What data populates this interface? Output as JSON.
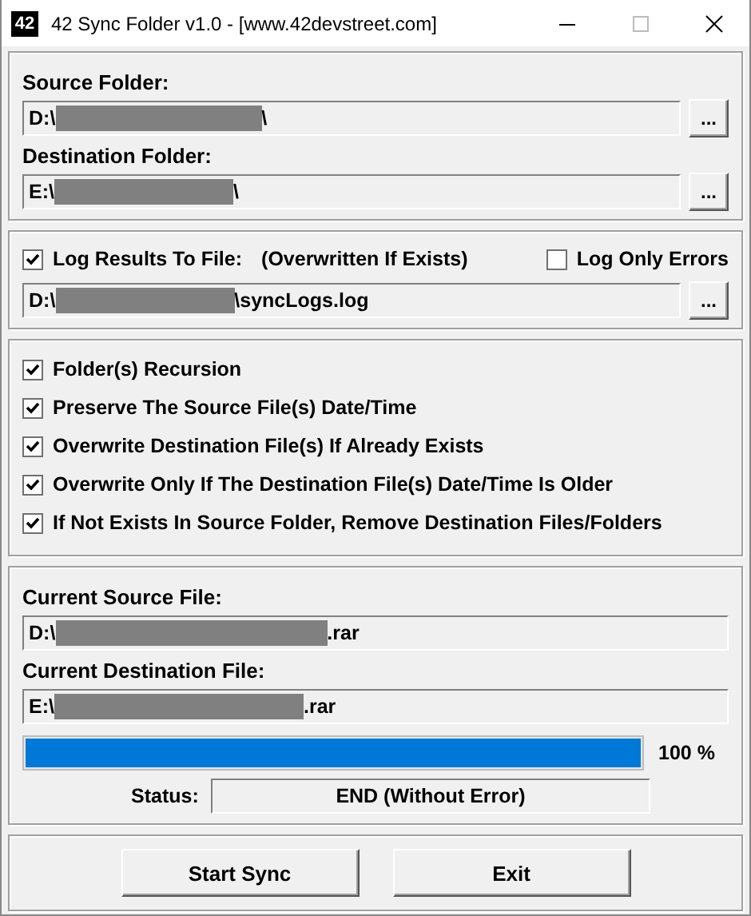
{
  "window": {
    "title": "42 Sync Folder v1.0 - [www.42devstreet.com]",
    "icon_text": "42"
  },
  "folders": [
    {
      "label": "Source Folder:",
      "browse": "...",
      "value": [
        {
          "kind": "text",
          "text": "D:\\"
        },
        {
          "kind": "redacted"
        },
        {
          "kind": "text",
          "text": "\\"
        }
      ]
    },
    {
      "label": "Destination Folder:",
      "browse": "...",
      "value": [
        {
          "kind": "text",
          "text": "E:\\"
        },
        {
          "kind": "redacted"
        },
        {
          "kind": "text",
          "text": "\\"
        }
      ]
    }
  ],
  "log": {
    "log_results": {
      "label": "Log Results To File:",
      "checked": true
    },
    "note": "(Overwritten If Exists)",
    "only_errors": {
      "label": "Log Only Errors",
      "checked": false
    },
    "browse": "...",
    "value": [
      {
        "kind": "text",
        "text": "D:\\"
      },
      {
        "kind": "redacted"
      },
      {
        "kind": "text",
        "text": "\\syncLogs.log"
      }
    ]
  },
  "options": [
    {
      "label": "Folder(s) Recursion",
      "checked": true
    },
    {
      "label": "Preserve The Source File(s) Date/Time",
      "checked": true
    },
    {
      "label": "Overwrite Destination File(s) If Already Exists",
      "checked": true
    },
    {
      "label": "Overwrite Only If The Destination File(s) Date/Time Is Older",
      "checked": true
    },
    {
      "label": "If Not Exists In Source Folder, Remove Destination Files/Folders",
      "checked": true
    }
  ],
  "progress": {
    "files": [
      {
        "label": "Current Source File:",
        "value": [
          {
            "kind": "text",
            "text": "D:\\"
          },
          {
            "kind": "redacted"
          },
          {
            "kind": "text",
            "text": ".rar"
          }
        ]
      },
      {
        "label": "Current Destination File:",
        "value": [
          {
            "kind": "text",
            "text": "E:\\"
          },
          {
            "kind": "redacted"
          },
          {
            "kind": "text",
            "text": ".rar"
          }
        ]
      }
    ],
    "level": 1,
    "percent": "100 %",
    "status_label": "Status:",
    "status": "END (Without Error)"
  },
  "buttons": [
    "Start Sync",
    "Exit"
  ]
}
